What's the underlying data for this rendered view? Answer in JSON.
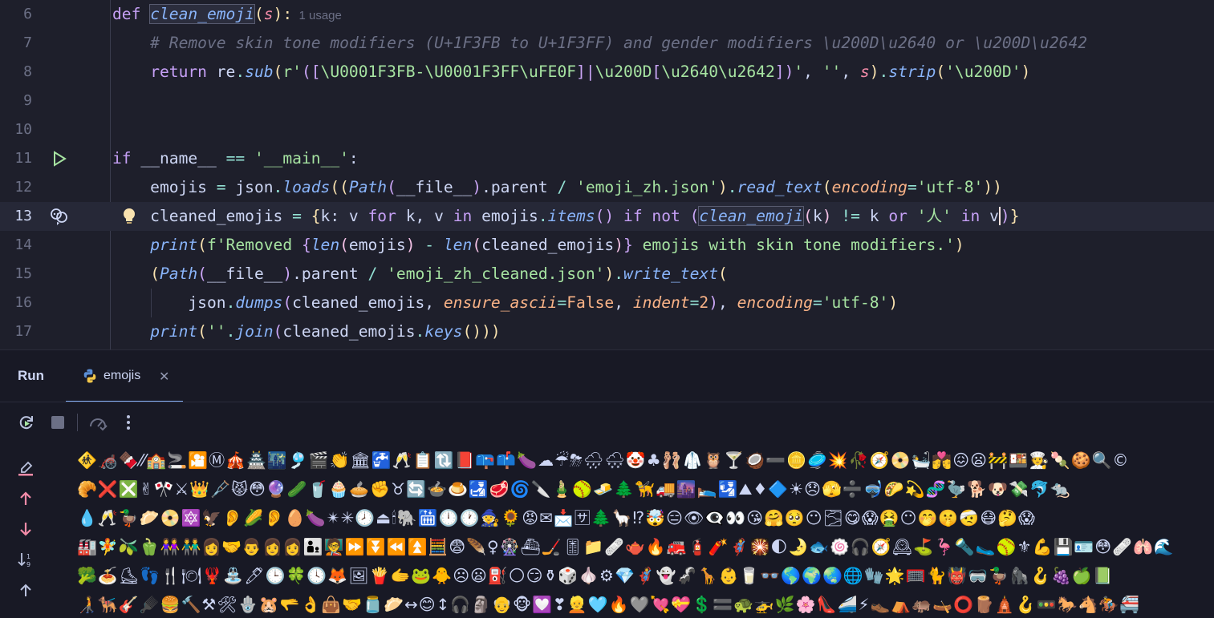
{
  "editor": {
    "lines": [
      {
        "num": "6",
        "segments": [
          {
            "t": "def ",
            "c": "kw"
          },
          {
            "t": "clean_emoji",
            "c": "fn-def hl-box"
          },
          {
            "t": "(",
            "c": "br1"
          },
          {
            "t": "s",
            "c": "param"
          },
          {
            "t": "):",
            "c": "br1"
          },
          {
            "t": "  1 usage",
            "c": "hint"
          }
        ]
      },
      {
        "num": "7",
        "segments": [
          {
            "t": "    # Remove skin tone modifiers (U+1F3FB to U+1F3FF) and gender modifiers \\u200D\\u2640 or \\u200D\\u2642",
            "c": "cm"
          }
        ]
      },
      {
        "num": "8",
        "segments": [
          {
            "t": "    ",
            "c": ""
          },
          {
            "t": "return ",
            "c": "kw"
          },
          {
            "t": "re",
            "c": ""
          },
          {
            "t": ".",
            "c": "op"
          },
          {
            "t": "sub",
            "c": "call"
          },
          {
            "t": "(",
            "c": "br1"
          },
          {
            "t": "r'",
            "c": "str"
          },
          {
            "t": "([",
            "c": "br2"
          },
          {
            "t": "\\U0001F3FB-\\U0001F3FF\\uFE0F",
            "c": "str"
          },
          {
            "t": "]|",
            "c": "br2"
          },
          {
            "t": "\\u200D",
            "c": "str"
          },
          {
            "t": "[",
            "c": "br2"
          },
          {
            "t": "\\u2640\\u2642",
            "c": "str"
          },
          {
            "t": "])",
            "c": "br2"
          },
          {
            "t": "'",
            "c": "str"
          },
          {
            "t": ", ",
            "c": ""
          },
          {
            "t": "''",
            "c": "str"
          },
          {
            "t": ", ",
            "c": ""
          },
          {
            "t": "s",
            "c": "param"
          },
          {
            "t": ")",
            "c": "br1"
          },
          {
            "t": ".",
            "c": "op"
          },
          {
            "t": "strip",
            "c": "call"
          },
          {
            "t": "(",
            "c": "br1"
          },
          {
            "t": "'\\u200D'",
            "c": "str"
          },
          {
            "t": ")",
            "c": "br1"
          }
        ]
      },
      {
        "num": "9",
        "segments": []
      },
      {
        "num": "10",
        "segments": []
      },
      {
        "num": "11",
        "segments": [
          {
            "t": "if ",
            "c": "kw"
          },
          {
            "t": "__name__ ",
            "c": ""
          },
          {
            "t": "== ",
            "c": "op"
          },
          {
            "t": "'__main__'",
            "c": "str"
          },
          {
            "t": ":",
            "c": ""
          }
        ]
      },
      {
        "num": "12",
        "segments": [
          {
            "t": "    emojis ",
            "c": ""
          },
          {
            "t": "= ",
            "c": "op"
          },
          {
            "t": "json",
            "c": ""
          },
          {
            "t": ".",
            "c": "op"
          },
          {
            "t": "loads",
            "c": "call"
          },
          {
            "t": "((",
            "c": "br1"
          },
          {
            "t": "Path",
            "c": "cls"
          },
          {
            "t": "(",
            "c": "br2"
          },
          {
            "t": "__file__",
            "c": ""
          },
          {
            "t": ")",
            "c": "br2"
          },
          {
            "t": ".parent ",
            "c": ""
          },
          {
            "t": "/ ",
            "c": "op"
          },
          {
            "t": "'emoji_zh.json'",
            "c": "str"
          },
          {
            "t": ")",
            "c": "br1"
          },
          {
            "t": ".",
            "c": "op"
          },
          {
            "t": "read_text",
            "c": "call"
          },
          {
            "t": "(",
            "c": "br1"
          },
          {
            "t": "encoding",
            "c": "kwarg"
          },
          {
            "t": "=",
            "c": "op"
          },
          {
            "t": "'utf-8'",
            "c": "str"
          },
          {
            "t": "))",
            "c": "br1"
          }
        ]
      },
      {
        "num": "13",
        "current": true,
        "segments": [
          {
            "t": "    cleaned_emojis ",
            "c": ""
          },
          {
            "t": "= ",
            "c": "op"
          },
          {
            "t": "{",
            "c": "br1"
          },
          {
            "t": "k: v ",
            "c": ""
          },
          {
            "t": "for ",
            "c": "kw"
          },
          {
            "t": "k, v ",
            "c": ""
          },
          {
            "t": "in ",
            "c": "kw"
          },
          {
            "t": "emojis",
            "c": ""
          },
          {
            "t": ".",
            "c": "op"
          },
          {
            "t": "items",
            "c": "call"
          },
          {
            "t": "() ",
            "c": "br2"
          },
          {
            "t": "if not ",
            "c": "kw"
          },
          {
            "t": "(",
            "c": "br2"
          },
          {
            "t": "clean_emoji",
            "c": "call hl-box"
          },
          {
            "t": "(",
            "c": "pn"
          },
          {
            "t": "k",
            "c": ""
          },
          {
            "t": ") ",
            "c": "pn"
          },
          {
            "t": "!= ",
            "c": "op"
          },
          {
            "t": "k ",
            "c": ""
          },
          {
            "t": "or ",
            "c": "kw"
          },
          {
            "t": "'人' ",
            "c": "str"
          },
          {
            "t": "in ",
            "c": "kw"
          },
          {
            "t": "v",
            "c": ""
          },
          {
            "t": ")",
            "c": "br2 cursor"
          },
          {
            "t": "}",
            "c": "br1"
          }
        ]
      },
      {
        "num": "14",
        "segments": [
          {
            "t": "    ",
            "c": ""
          },
          {
            "t": "print",
            "c": "call"
          },
          {
            "t": "(",
            "c": "br1"
          },
          {
            "t": "f'Removed ",
            "c": "str"
          },
          {
            "t": "{",
            "c": "br2"
          },
          {
            "t": "len",
            "c": "call"
          },
          {
            "t": "(",
            "c": "pn"
          },
          {
            "t": "emojis",
            "c": ""
          },
          {
            "t": ") ",
            "c": "pn"
          },
          {
            "t": "- ",
            "c": "op"
          },
          {
            "t": "len",
            "c": "call"
          },
          {
            "t": "(",
            "c": "pn"
          },
          {
            "t": "cleaned_emojis",
            "c": ""
          },
          {
            "t": ")",
            "c": "pn"
          },
          {
            "t": "}",
            "c": "br2"
          },
          {
            "t": " emojis with skin tone modifiers.'",
            "c": "str"
          },
          {
            "t": ")",
            "c": "br1"
          }
        ]
      },
      {
        "num": "15",
        "segments": [
          {
            "t": "    ",
            "c": ""
          },
          {
            "t": "(",
            "c": "br1"
          },
          {
            "t": "Path",
            "c": "cls"
          },
          {
            "t": "(",
            "c": "br2"
          },
          {
            "t": "__file__",
            "c": ""
          },
          {
            "t": ")",
            "c": "br2"
          },
          {
            "t": ".parent ",
            "c": ""
          },
          {
            "t": "/ ",
            "c": "op"
          },
          {
            "t": "'emoji_zh_cleaned.json'",
            "c": "str"
          },
          {
            "t": ")",
            "c": "br1"
          },
          {
            "t": ".",
            "c": "op"
          },
          {
            "t": "write_text",
            "c": "call"
          },
          {
            "t": "(",
            "c": "br1"
          }
        ]
      },
      {
        "num": "16",
        "segments": [
          {
            "t": "        json",
            "c": ""
          },
          {
            "t": ".",
            "c": "op"
          },
          {
            "t": "dumps",
            "c": "call"
          },
          {
            "t": "(",
            "c": "br2"
          },
          {
            "t": "cleaned_emojis, ",
            "c": ""
          },
          {
            "t": "ensure_ascii",
            "c": "kwarg"
          },
          {
            "t": "=",
            "c": "op"
          },
          {
            "t": "False",
            "c": "const"
          },
          {
            "t": ", ",
            "c": ""
          },
          {
            "t": "indent",
            "c": "kwarg"
          },
          {
            "t": "=",
            "c": "op"
          },
          {
            "t": "2",
            "c": "num"
          },
          {
            "t": ")",
            "c": "br2"
          },
          {
            "t": ", ",
            "c": ""
          },
          {
            "t": "encoding",
            "c": "kwarg"
          },
          {
            "t": "=",
            "c": "op"
          },
          {
            "t": "'utf-8'",
            "c": "str"
          },
          {
            "t": ")",
            "c": "br1"
          }
        ]
      },
      {
        "num": "17",
        "segments": [
          {
            "t": "    ",
            "c": ""
          },
          {
            "t": "print",
            "c": "call"
          },
          {
            "t": "(",
            "c": "br1"
          },
          {
            "t": "''",
            "c": "str"
          },
          {
            "t": ".",
            "c": "op"
          },
          {
            "t": "join",
            "c": "call"
          },
          {
            "t": "(",
            "c": "br2"
          },
          {
            "t": "cleaned_emojis",
            "c": ""
          },
          {
            "t": ".",
            "c": "op"
          },
          {
            "t": "keys",
            "c": "call"
          },
          {
            "t": "()))",
            "c": "br1"
          }
        ]
      }
    ]
  },
  "run_panel": {
    "title": "Run",
    "tab_label": "emojis",
    "close_glyph": "✕",
    "toolbar_icons": [
      "rerun-icon",
      "stop-icon",
      "profiler-icon",
      "more-icon"
    ],
    "side_icons": [
      "clear-icon",
      "up-arrow-icon",
      "down-arrow-icon",
      "sort-icon",
      "scroll-top-icon"
    ],
    "output_lines": [
      "🚸🦽🍫⁄⁄🏫🚬🎦Ⓜ🎪🏯🌃🎐🎬👏🏛🚰🥂📋🔃📕📪📫🍆☁☔⛈🌧🌨🤡♣🩰🥼🦉🍸🥥➖🪙🥏💥🥀🧭📀🛀💏😖😦🚧🍱🧑‍🍳🍡🍪🔍©",
      "🥐❌❎✌🎌⚔👑🩼😾😳🔮🥒🥤🧁🥧✊♉🔄🍲🍮🛃🥩🌀🔪🎍🥎🧈🌲🦮🚚🌆🛌🛂⛰♦🔷☀😞🫣➗🤿🌮💫🧬🦤🐕🐶💸🐬🐀",
      "💧🥂🦆🥟📀🔯🦅👂🌽👂🥚🍆✴✳🕗⏏🕯🐘🛗🕛🕐🧙🌻😡✉📩🈂🌲🦙⁉🤯😑👁👁‍🗨👀😘🤗🥺😶🌫😋😱🤮😶🤭🤫🤕😷🤔😱",
      "🏭🧚🫒🫑👭👬👩‍🤝‍👨👩‍👩👨‍👦🧑‍🏫⏩⏬⏪⏫🧮😨🪶♀🎡⛴🏒🎚📁🩹🫖🔥🚒🧯🧨🦸🎇🌓🌛🐟🍥🎧🧭🕰⛳🦩🔦🥿🥎⚜💪💾🪪😳🩹🫁🌊",
      "🥦🍝⛸👣🍴🍽🦞⛲🖊🕒🍀🕓🦊🖼🍟🫱🐸🐥☹😦⛽🌕😏⚱🎲🧄⚙💎🦸👻🦨🦒👶🥛👓🌎🌍🌏🌐🧤🌟🥅🐈👹🥽🦆🦍🪝🍇🍏📗",
      "🧑‍🦯🐕‍🦺🎸🪮🍔🔨⚒🛠🪬🐹🫳👌👜🤝🫙🥟↔😊↕🎧🗿👴🐵💟❣👱🩵🔥🩶💘💝💲🟰🐢🚁🌿🌸👠🚄⚡👞⛺🦛🛶⭕🪵🛕🪝🚥🐎🐴🏇🚝"
    ]
  }
}
